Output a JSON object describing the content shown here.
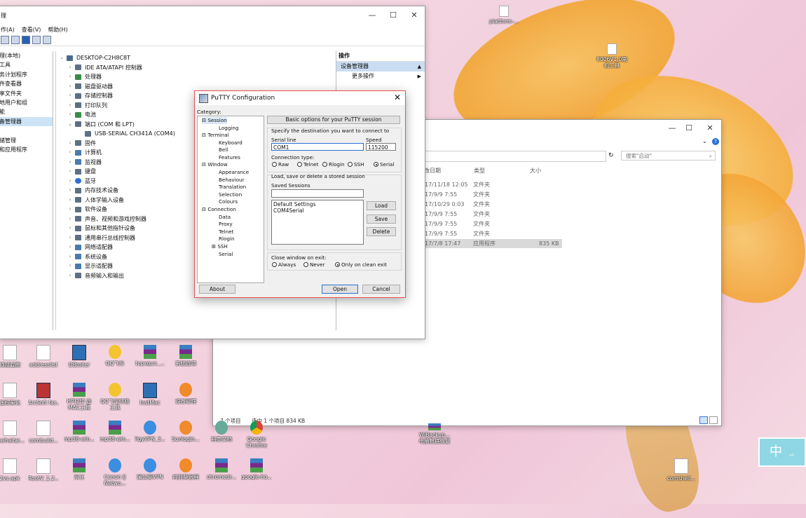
{
  "device_manager": {
    "title": "理",
    "menu": [
      "作(A)",
      "查看(V)",
      "帮助(H)"
    ],
    "left_items": [
      "理(本地)",
      "工具",
      "务计划程序",
      "件查看器",
      "享文件夹",
      "地用户和组",
      "能",
      "备管理器",
      "",
      "储管理",
      "和应用程序"
    ],
    "tree_root": "DESKTOP-C2H8C8T",
    "tree": [
      {
        "label": "IDE ATA/ATAPI 控制器",
        "expanded": false
      },
      {
        "label": "处理器",
        "expanded": false
      },
      {
        "label": "磁盘驱动器",
        "expanded": false
      },
      {
        "label": "存储控制器",
        "expanded": false
      },
      {
        "label": "打印队列",
        "expanded": false
      },
      {
        "label": "电池",
        "expanded": false
      },
      {
        "label": "端口 (COM 和 LPT)",
        "expanded": true
      },
      {
        "label": "USB-SERIAL CH341A (COM4)",
        "child": true
      },
      {
        "label": "固件",
        "expanded": false
      },
      {
        "label": "计算机",
        "expanded": false
      },
      {
        "label": "监视器",
        "expanded": false
      },
      {
        "label": "键盘",
        "expanded": false
      },
      {
        "label": "蓝牙",
        "expanded": false
      },
      {
        "label": "内存技术设备",
        "expanded": false
      },
      {
        "label": "人体学输入设备",
        "expanded": false
      },
      {
        "label": "软件设备",
        "expanded": false
      },
      {
        "label": "声音、视频和游戏控制器",
        "expanded": false
      },
      {
        "label": "鼠标和其他指针设备",
        "expanded": false
      },
      {
        "label": "通用串行总线控制器",
        "expanded": false
      },
      {
        "label": "网络适配器",
        "expanded": false
      },
      {
        "label": "系统设备",
        "expanded": false
      },
      {
        "label": "显示适配器",
        "expanded": false
      },
      {
        "label": "音频输入和输出",
        "expanded": false
      }
    ],
    "actions_header": "操作",
    "actions_selected": "设备管理器",
    "actions_more": "更多操作"
  },
  "explorer": {
    "search_placeholder": "搜索\"启动\"",
    "col_date": "改日期",
    "col_type": "类型",
    "col_size": "大小",
    "rows": [
      {
        "date": "17/11/18 12:05",
        "type": "文件夹",
        "size": ""
      },
      {
        "date": "17/9/9 7:55",
        "type": "文件夹",
        "size": ""
      },
      {
        "date": "17/10/29 0:03",
        "type": "文件夹",
        "size": ""
      },
      {
        "date": "17/9/9 7:55",
        "type": "文件夹",
        "size": ""
      },
      {
        "date": "17/9/9 7:55",
        "type": "文件夹",
        "size": ""
      },
      {
        "date": "17/9/9 7:55",
        "type": "文件夹",
        "size": ""
      },
      {
        "date": "17/7/8 17:47",
        "type": "应用程序",
        "size": "835 KB"
      }
    ],
    "status_items": "7 个项目",
    "status_selected": "选中 1 个项目  834 KB"
  },
  "putty": {
    "title": "PuTTY Configuration",
    "category_label": "Category:",
    "tree": [
      {
        "label": "Session",
        "level": 0,
        "box": "-",
        "selected": true
      },
      {
        "label": "Logging",
        "level": 1
      },
      {
        "label": "Terminal",
        "level": 0,
        "box": "-"
      },
      {
        "label": "Keyboard",
        "level": 1
      },
      {
        "label": "Bell",
        "level": 1
      },
      {
        "label": "Features",
        "level": 1
      },
      {
        "label": "Window",
        "level": 0,
        "box": "-"
      },
      {
        "label": "Appearance",
        "level": 1
      },
      {
        "label": "Behaviour",
        "level": 1
      },
      {
        "label": "Translation",
        "level": 1
      },
      {
        "label": "Selection",
        "level": 1
      },
      {
        "label": "Colours",
        "level": 1
      },
      {
        "label": "Connection",
        "level": 0,
        "box": "-"
      },
      {
        "label": "Data",
        "level": 1
      },
      {
        "label": "Proxy",
        "level": 1
      },
      {
        "label": "Telnet",
        "level": 1
      },
      {
        "label": "Rlogin",
        "level": 1
      },
      {
        "label": "SSH",
        "level": 1,
        "box": "+"
      },
      {
        "label": "Serial",
        "level": 1
      }
    ],
    "panel_title": "Basic options for your PuTTY session",
    "dest_label": "Specify the destination you want to connect to",
    "serial_line_label": "Serial line",
    "serial_line_value": "COM1",
    "speed_label": "Speed",
    "speed_value": "115200",
    "conn_type_label": "Connection type:",
    "conn_types": [
      "Raw",
      "Telnet",
      "Rlogin",
      "SSH",
      "Serial"
    ],
    "conn_selected": "Serial",
    "sessions_group_label": "Load, save or delete a stored session",
    "saved_sessions_label": "Saved Sessions",
    "saved_sessions_value": "",
    "sessions": [
      "Default Settings",
      "COM4Serial"
    ],
    "load": "Load",
    "save": "Save",
    "delete": "Delete",
    "close_label": "Close window on exit:",
    "close_options": [
      "Always",
      "Never",
      "Only on clean exit"
    ],
    "close_selected": "Only on clean exit",
    "about": "About",
    "open": "Open",
    "cancel": "Cancel"
  },
  "desktop": {
    "top_icons": [
      {
        "name": "platform-...",
        "type": "file"
      },
      {
        "name": "8006V1.0刷机工具",
        "type": "file"
      }
    ],
    "icons": [
      [
        "顶部截图",
        "addresslist",
        "DBtoller",
        "QQ飞车",
        "tcpxgun_...",
        "系统选项"
      ],
      [
        "遥控美化",
        "ArcSoft fas...",
        "HP打印 连 MAC工具",
        "QQ飞车终极工具",
        "InstMac",
        "设备管理"
      ],
      [
        "meihaitai...",
        "combuild...",
        "mp38-win...",
        "mp38-win...",
        "PgyVPN_3...",
        "Sunlogin..."
      ],
      [
        "2vs.apk",
        "RootV_1.2...",
        "东江",
        "Canon IJ Netwo...",
        "蒲公英VPN",
        "向日葵远程"
      ]
    ],
    "row3_extra": [
      "石墨文档",
      "Google Chrome"
    ],
    "row4_extra": [
      "chromedr...",
      "google-ho..."
    ],
    "bottom_right": [
      {
        "name": "WiBackup... 电脑数据恢复"
      },
      {
        "name": "comshell..."
      }
    ],
    "ime_text": "中"
  }
}
